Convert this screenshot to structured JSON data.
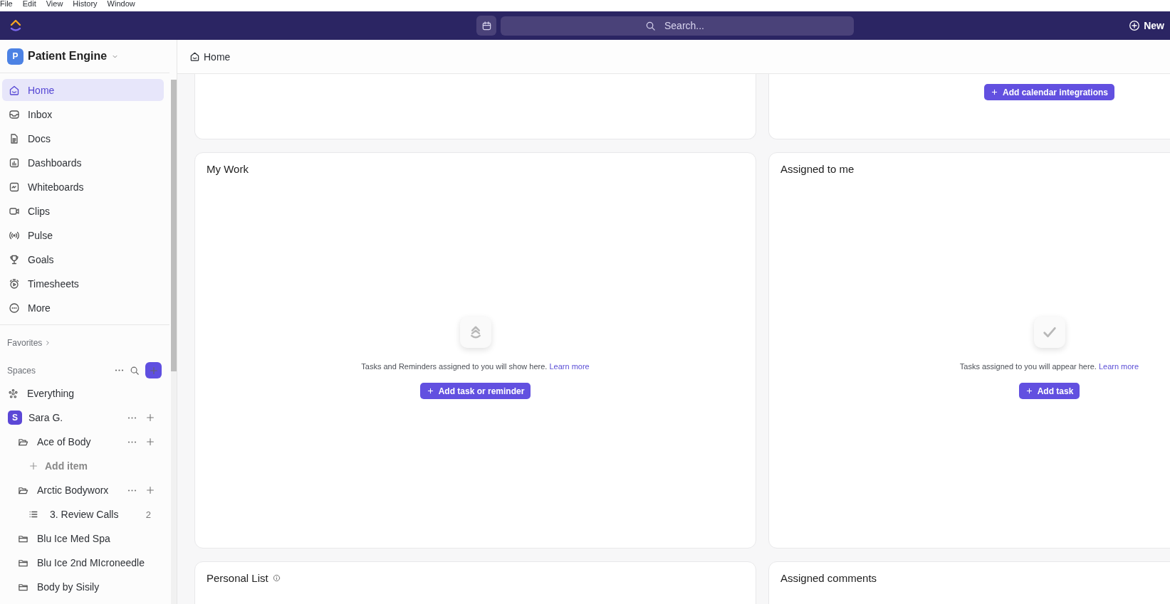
{
  "menu_bar": [
    "File",
    "Edit",
    "View",
    "History",
    "Window"
  ],
  "top_bar": {
    "search": {
      "placeholder": "Search..."
    },
    "new_button": "New"
  },
  "workspace": {
    "initial": "P",
    "name": "Patient Engine"
  },
  "nav": [
    {
      "label": "Home",
      "selected": true
    },
    {
      "label": "Inbox",
      "selected": false
    },
    {
      "label": "Docs",
      "selected": false
    },
    {
      "label": "Dashboards",
      "selected": false
    },
    {
      "label": "Whiteboards",
      "selected": false
    },
    {
      "label": "Clips",
      "selected": false
    },
    {
      "label": "Pulse",
      "selected": false
    },
    {
      "label": "Goals",
      "selected": false
    },
    {
      "label": "Timesheets",
      "selected": false
    },
    {
      "label": "More",
      "selected": false
    }
  ],
  "favorites": "Favorites",
  "spaces": {
    "label": "Spaces",
    "items": [
      {
        "kind": "everything",
        "label": "Everything",
        "actions": false
      },
      {
        "kind": "space",
        "initial": "S",
        "label": "Sara G.",
        "actions": true,
        "children": [
          {
            "kind": "folder",
            "label": "Ace of Body",
            "expanded": true,
            "actions": true,
            "children": [
              {
                "kind": "add",
                "label": "Add item",
                "actions": false
              }
            ]
          },
          {
            "kind": "folder",
            "label": "Arctic Bodyworx",
            "expanded": true,
            "actions": true,
            "children": [
              {
                "kind": "list",
                "label": "3. Review Calls",
                "count": "2",
                "actions": false
              }
            ]
          },
          {
            "kind": "folder",
            "label": "Blu Ice Med Spa",
            "expanded": false,
            "actions": false
          },
          {
            "kind": "folder",
            "label": "Blu Ice 2nd MIcroneedle",
            "expanded": false,
            "actions": false
          },
          {
            "kind": "folder",
            "label": "Body by Sisily",
            "expanded": false,
            "actions": false
          }
        ]
      }
    ]
  },
  "breadcrumb": "Home",
  "cards": [
    {
      "kind": "top",
      "info": false
    },
    {
      "kind": "top",
      "info": false,
      "button": "Add calendar integrations"
    },
    {
      "kind": "empty",
      "title": "My Work",
      "info": false,
      "message": "Tasks and Reminders assigned to you will show here.",
      "link": "Learn more",
      "button": "Add task or reminder"
    },
    {
      "kind": "empty",
      "title": "Assigned to me",
      "info": false,
      "message": "Tasks assigned to you will appear here.",
      "link": "Learn more",
      "button": "Add task"
    },
    {
      "title": "Personal List",
      "info": true
    },
    {
      "title": "Assigned comments",
      "info": false
    }
  ]
}
